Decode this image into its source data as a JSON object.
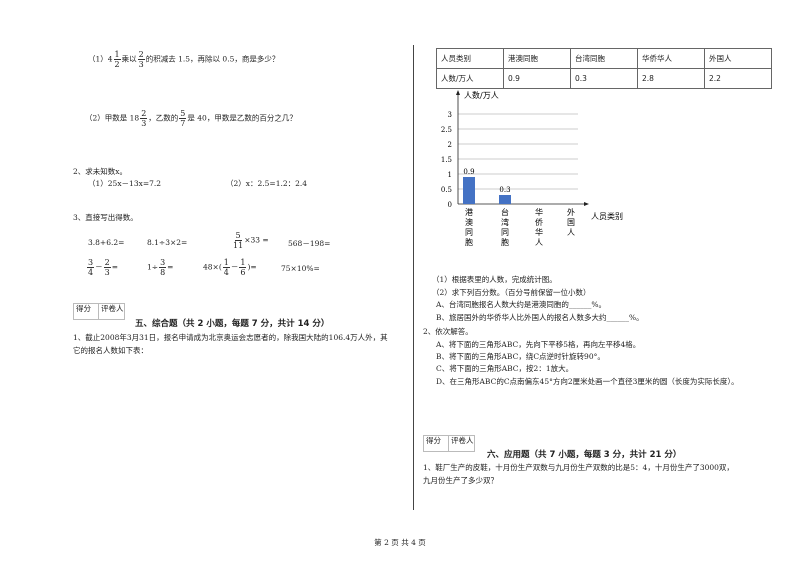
{
  "left": {
    "q1_1": {
      "prefix": "（1）4",
      "f1": [
        "1",
        "2"
      ],
      "mid": "乘以",
      "f2": [
        "2",
        "3"
      ],
      "suffix": "的积减去 1.5，再除以 0.5，商是多少？"
    },
    "q1_2": {
      "prefix": "（2）甲数是 18",
      "f1": [
        "2",
        "3"
      ],
      "mid": "，乙数的",
      "f2": [
        "5",
        "7"
      ],
      "suffix": "是 40，甲数是乙数的百分之几？"
    },
    "q2_title": "2、求未知数x。",
    "q2_items": [
      "（1）25x－13x=7.2",
      "（2）x：2.5=1.2：2.4"
    ],
    "q3_title": "3、直接写出得数。",
    "q3_row1": [
      "3.8+6.2=",
      "8.1÷3×2=",
      "×33 =",
      "568－198="
    ],
    "q3_frac1": [
      "5",
      "11"
    ],
    "q3_row2": {
      "a": [
        "3",
        "4",
        "2",
        "3"
      ],
      "b": "1÷",
      "bf": [
        "3",
        "8"
      ],
      "c": "48×(",
      "cf1": [
        "1",
        "4"
      ],
      "cf2": [
        "1",
        "6"
      ],
      "d": "75×10%="
    },
    "score_box": [
      "得分",
      "评卷人"
    ],
    "section5_title": "五、综合题（共 2 小题，每题 7 分，共计 14 分）",
    "s5_q1": [
      "1、截止2008年3月31日，报名申请成为北京奥运会志愿者的，除我国大陆的106.4万人外，其",
      "它的报名人数如下表："
    ]
  },
  "right": {
    "table": {
      "header": [
        "人员类别",
        "港澳同胞",
        "台湾同胞",
        "华侨华人",
        "外国人"
      ],
      "row": [
        "人数/万人",
        "0.9",
        "0.3",
        "2.8",
        "2.2"
      ]
    },
    "lines": [
      "（1）根据表里的人数，完成统计图。",
      "（2）求下列百分数。（百分号前保留一位小数）",
      "A、台湾同胞报名人数大约是港澳同胞的______%。",
      "B、旅居国外的华侨华人比外国人的报名人数多大约______%。",
      "2、依次解答。",
      "A、将下面的三角形ABC，先向下平移5格，再向左平移4格。",
      "B、将下面的三角形ABC，绕C点逆时针旋转90°。",
      "C、将下面的三角形ABC，按2：1放大。",
      "D、在三角形ABC的C点南偏东45°方向2厘米处画一个直径3厘米的圆（长度为实际长度）。"
    ],
    "score_box": [
      "得分",
      "评卷人"
    ],
    "section6_title": "六、应用题（共 7 小题，每题 3 分，共计 21 分）",
    "s6_q1": [
      "1、鞋厂生产的皮鞋，十月份生产双数与九月份生产双数的比是5：4，十月份生产了3000双，",
      "九月份生产了多少双？"
    ]
  },
  "chart_data": {
    "type": "bar",
    "ylabel": "人数/万人",
    "xlabel": "人员类别",
    "categories": [
      "港澳同胞",
      "台湾同胞",
      "华侨华人",
      "外国人"
    ],
    "values": [
      0.9,
      0.3,
      null,
      null
    ],
    "data_labels": [
      "0.9",
      "0.3",
      "",
      ""
    ],
    "yticks": [
      "0",
      "0.5",
      "1",
      "1.5",
      "2",
      "2.5",
      "3"
    ],
    "ylim": [
      0,
      3
    ],
    "grid": true,
    "bar_color": "#4472c4"
  },
  "footer": "第 2 页 共 4 页"
}
